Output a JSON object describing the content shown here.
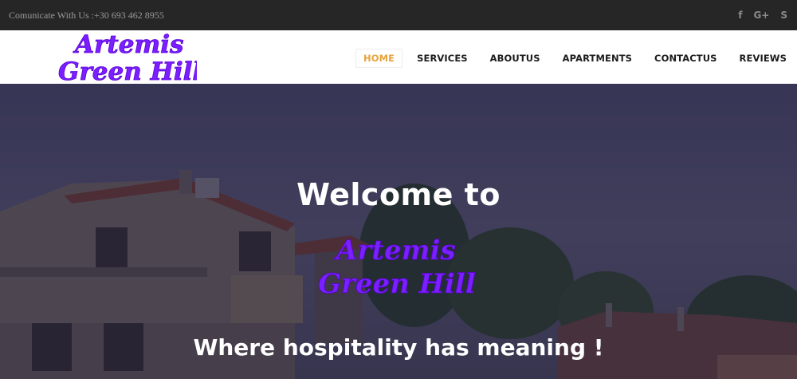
{
  "topbar": {
    "contact_text": "Comunicate With Us :+30 693 462 8955",
    "social_icons": [
      {
        "name": "facebook-icon",
        "glyph": "f"
      },
      {
        "name": "google-plus-icon",
        "glyph": "G+"
      },
      {
        "name": "skype-icon",
        "glyph": "S"
      }
    ]
  },
  "header": {
    "logo": {
      "line1": "Artemis",
      "line2": "Green Hill"
    },
    "nav": [
      {
        "label": "HOME",
        "active": true
      },
      {
        "label": "SERVICES",
        "active": false
      },
      {
        "label": "ABOUTUS",
        "active": false
      },
      {
        "label": "APARTMENTS",
        "active": false
      },
      {
        "label": "CONTACTUS",
        "active": false
      },
      {
        "label": "REVIEWS",
        "active": false
      }
    ]
  },
  "hero": {
    "welcome": "Welcome to",
    "logo": {
      "line1": "Artemis",
      "line2": "Green Hill"
    },
    "tagline": "Where hospitality has meaning !"
  },
  "colors": {
    "logo_purple": "#7a1fff",
    "nav_active": "#e8a33a",
    "topbar_bg": "#262626"
  }
}
